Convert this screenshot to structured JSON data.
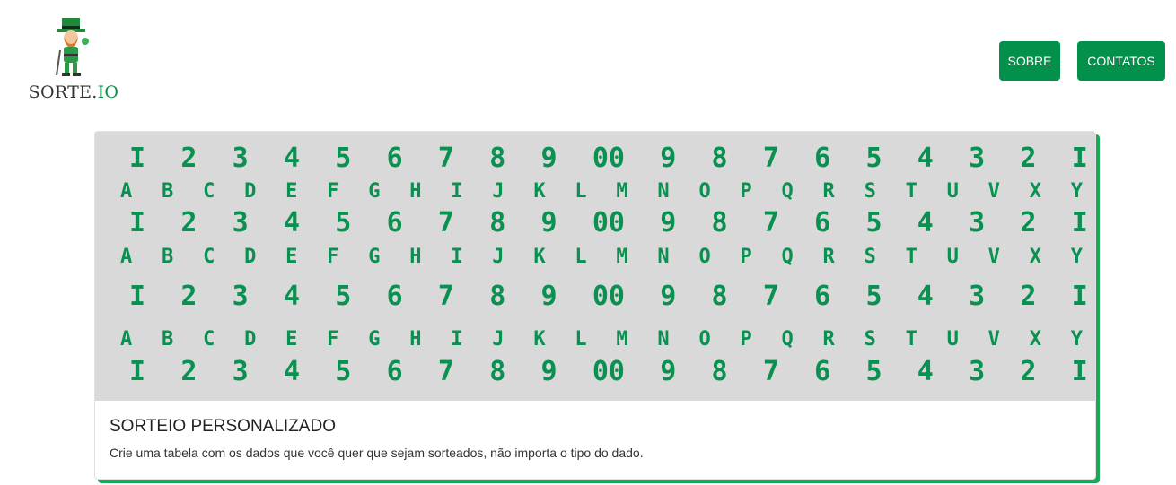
{
  "brand": {
    "name_main": "SORTE.",
    "name_suffix": "IO"
  },
  "nav": {
    "sobre": "SOBRE",
    "contatos": "CONTATOS"
  },
  "card": {
    "title": "SORTEIO PERSONALIZADO",
    "text": "Crie uma tabela com os dados que você quer que sejam sorteados, não importa o tipo do dado.",
    "number_rows": [
      [
        "I",
        "2",
        "3",
        "4",
        "5",
        "6",
        "7",
        "8",
        "9",
        "00",
        "9",
        "8",
        "7",
        "6",
        "5",
        "4",
        "3",
        "2",
        "I"
      ],
      [
        "I",
        "2",
        "3",
        "4",
        "5",
        "6",
        "7",
        "8",
        "9",
        "00",
        "9",
        "8",
        "7",
        "6",
        "5",
        "4",
        "3",
        "2",
        "I"
      ],
      [
        "I",
        "2",
        "3",
        "4",
        "5",
        "6",
        "7",
        "8",
        "9",
        "00",
        "9",
        "8",
        "7",
        "6",
        "5",
        "4",
        "3",
        "2",
        "I"
      ],
      [
        "I",
        "2",
        "3",
        "4",
        "5",
        "6",
        "7",
        "8",
        "9",
        "00",
        "9",
        "8",
        "7",
        "6",
        "5",
        "4",
        "3",
        "2",
        "I"
      ]
    ],
    "letter_rows": [
      [
        "A",
        "B",
        "C",
        "D",
        "E",
        "F",
        "G",
        "H",
        "I",
        "J",
        "K",
        "L",
        "M",
        "N",
        "O",
        "P",
        "Q",
        "R",
        "S",
        "T",
        "U",
        "V",
        "X",
        "Y"
      ],
      [
        "A",
        "B",
        "C",
        "D",
        "E",
        "F",
        "G",
        "H",
        "I",
        "J",
        "K",
        "L",
        "M",
        "N",
        "O",
        "P",
        "Q",
        "R",
        "S",
        "T",
        "U",
        "V",
        "X",
        "Y"
      ],
      [
        "A",
        "B",
        "C",
        "D",
        "E",
        "F",
        "G",
        "H",
        "I",
        "J",
        "K",
        "L",
        "M",
        "N",
        "O",
        "P",
        "Q",
        "R",
        "S",
        "T",
        "U",
        "V",
        "X",
        "Y"
      ]
    ]
  },
  "colors": {
    "accent": "#03904b",
    "shadow": "#18a957",
    "glyph": "#0a9050",
    "image_bg": "#d9d9d9"
  }
}
